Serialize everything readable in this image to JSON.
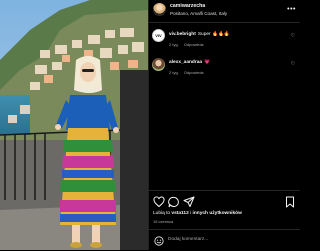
{
  "header": {
    "username": "camiwarzecha",
    "location": "Positano, Amalfi Coast, Italy",
    "more_label": "•••"
  },
  "comments": [
    {
      "avatar_text": "VIV",
      "username": "viv.bebright",
      "text": "Super 🔥🔥🔥",
      "age": "2 tyg.",
      "reply": "Odpowiedz"
    },
    {
      "username": "alexx_aandraa",
      "text": "💗",
      "age": "2 tyg.",
      "reply": "Odpowiedz"
    }
  ],
  "icons": [
    "heart-icon",
    "comment-icon",
    "share-icon",
    "bookmark-icon",
    "smile-icon"
  ],
  "likes": {
    "prefix": "Lubią to",
    "user": "vsta112",
    "middle": "i",
    "others": "innych użytkowników"
  },
  "date": "15 czerwca",
  "add_comment": {
    "placeholder": "Dodaj komentarz..."
  },
  "colors": {
    "background": "#000000",
    "text": "#f5f5f5",
    "muted": "#a8a8a8",
    "divider": "#262626"
  }
}
